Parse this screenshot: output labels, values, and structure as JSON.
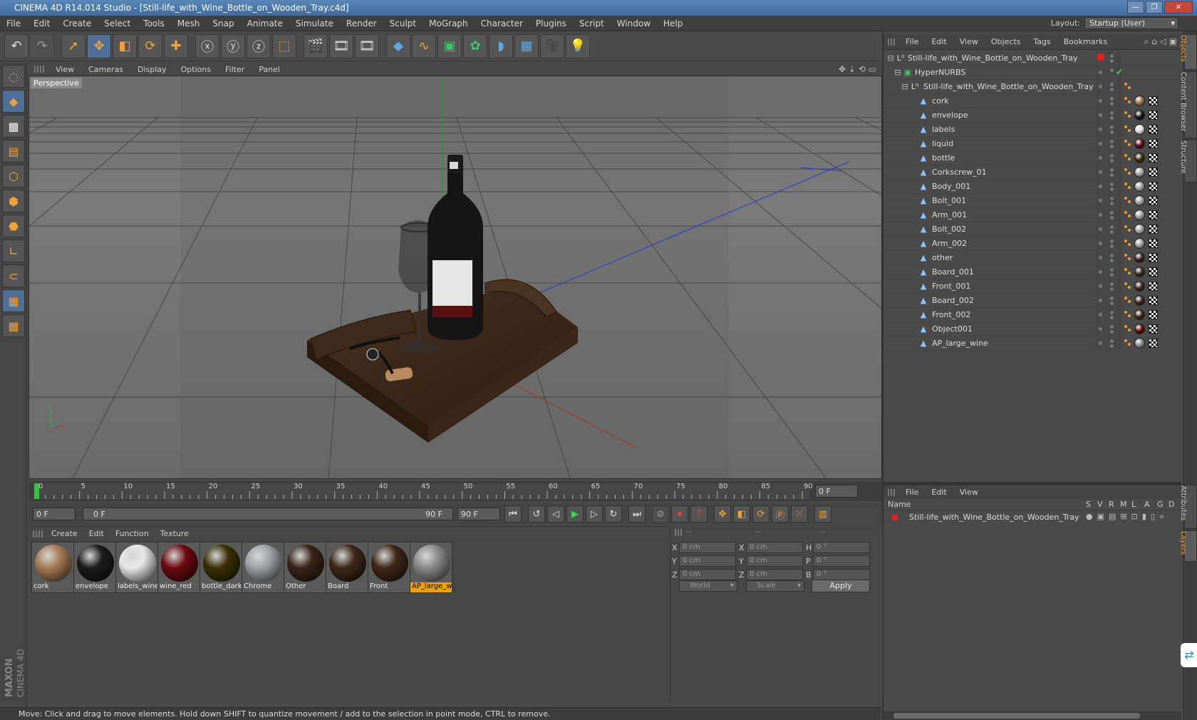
{
  "window": {
    "title": "CINEMA 4D R14.014 Studio - [Still-life_with_Wine_Bottle_on_Wooden_Tray.c4d]"
  },
  "menu": [
    "File",
    "Edit",
    "Create",
    "Select",
    "Tools",
    "Mesh",
    "Snap",
    "Animate",
    "Simulate",
    "Render",
    "Sculpt",
    "MoGraph",
    "Character",
    "Plugins",
    "Script",
    "Window",
    "Help"
  ],
  "layout": {
    "label": "Layout:",
    "value": "Startup (User)"
  },
  "viewport": {
    "menu": [
      "View",
      "Cameras",
      "Display",
      "Options",
      "Filter",
      "Panel"
    ],
    "label": "Perspective"
  },
  "timeline": {
    "ticks": [
      "0",
      "5",
      "10",
      "15",
      "20",
      "25",
      "30",
      "35",
      "40",
      "45",
      "50",
      "55",
      "60",
      "65",
      "70",
      "75",
      "80",
      "85",
      "90"
    ],
    "current_frame": "0 F",
    "start_frame": "0 F",
    "range_start": "0 F",
    "range_end": "90 F",
    "end_frame": "90 F"
  },
  "materials": {
    "menu": [
      "Create",
      "Edit",
      "Function",
      "Texture"
    ],
    "items": [
      {
        "label": "cork",
        "color": "#a57b55"
      },
      {
        "label": "envelope",
        "color": "#1c1c1c"
      },
      {
        "label": "labels_wine",
        "color": "#e8e8e8"
      },
      {
        "label": "wine_red",
        "color": "#6a0a10"
      },
      {
        "label": "bottle_dark",
        "color": "#3b3008"
      },
      {
        "label": "Chrome",
        "color": "#9ea2a6"
      },
      {
        "label": "Other",
        "color": "#3a2418"
      },
      {
        "label": "Board",
        "color": "#3e281a"
      },
      {
        "label": "Front",
        "color": "#3f2719"
      },
      {
        "label": "AP_large_wine",
        "color": "#8a8a8a"
      }
    ]
  },
  "coordinates": {
    "headers": [
      "--",
      "--",
      "--"
    ],
    "rows": [
      {
        "a": "X",
        "av": "0 cm",
        "b": "X",
        "bv": "0 cm",
        "c": "H",
        "cv": "0 °"
      },
      {
        "a": "Y",
        "av": "0 cm",
        "b": "Y",
        "bv": "0 cm",
        "c": "P",
        "cv": "0 °"
      },
      {
        "a": "Z",
        "av": "0 cm",
        "b": "Z",
        "bv": "0 cm",
        "c": "B",
        "cv": "0 °"
      }
    ],
    "space": "World",
    "mode": "Scale",
    "apply": "Apply"
  },
  "status": "Move: Click and drag to move elements. Hold down SHIFT to quantize movement / add to the selection in point mode, CTRL to remove.",
  "objects": {
    "menu": [
      "File",
      "Edit",
      "View",
      "Objects",
      "Tags",
      "Bookmarks"
    ],
    "root": "Still-life_with_Wine_Bottle_on_Wooden_Tray",
    "hypernurbs": "HyperNURBS",
    "group": "Still-life_with_Wine_Bottle_on_Wooden_Tray",
    "items": [
      {
        "name": "cork",
        "tag": "#9b7352"
      },
      {
        "name": "envelope",
        "tag": "#151515"
      },
      {
        "name": "labels",
        "tag": "#dcdcdc"
      },
      {
        "name": "liquid",
        "tag": "#5e0a0e"
      },
      {
        "name": "bottle",
        "tag": "#3a2e08"
      },
      {
        "name": "Corkscrew_01",
        "tag": "#a0a0a0"
      },
      {
        "name": "Body_001",
        "tag": "#a0a0a0"
      },
      {
        "name": "Bolt_001",
        "tag": "#a0a0a0"
      },
      {
        "name": "Arm_001",
        "tag": "#a0a0a0"
      },
      {
        "name": "Bolt_002",
        "tag": "#a0a0a0"
      },
      {
        "name": "Arm_002",
        "tag": "#a0a0a0"
      },
      {
        "name": "other",
        "tag": "#3a2418"
      },
      {
        "name": "Board_001",
        "tag": "#3e281a"
      },
      {
        "name": "Front_001",
        "tag": "#3e281a"
      },
      {
        "name": "Board_002",
        "tag": "#3e281a"
      },
      {
        "name": "Front_002",
        "tag": "#3e281a"
      },
      {
        "name": "Object001",
        "tag": "#5e0a0e"
      },
      {
        "name": "AP_large_wine",
        "tag": "#8a8a8a"
      }
    ]
  },
  "attributes": {
    "menu": [
      "File",
      "Edit",
      "View"
    ],
    "columns": [
      "Name",
      "S",
      "V",
      "R",
      "M",
      "L",
      "A",
      "G",
      "D"
    ],
    "row": "Still-life_with_Wine_Bottle_on_Wooden_Tray"
  },
  "right_tabs": [
    "Objects",
    "Content Browser",
    "Structure",
    "Attributes",
    "Layers"
  ],
  "branding": {
    "maxon": "MAXON",
    "product": "CINEMA 4D"
  }
}
